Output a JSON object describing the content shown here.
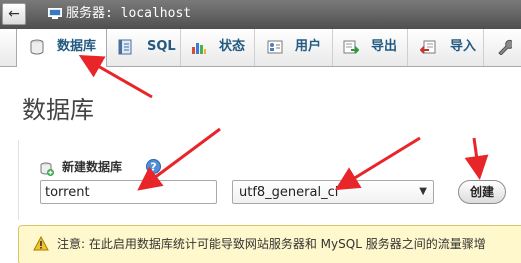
{
  "topbar": {
    "back_label": "←",
    "server_label": "服务器: localhost"
  },
  "tabs": [
    {
      "label": "数据库",
      "icon": "database-icon",
      "active": true
    },
    {
      "label": "SQL",
      "icon": "sql-icon",
      "active": false
    },
    {
      "label": "状态",
      "icon": "status-chart-icon",
      "active": false
    },
    {
      "label": "用户",
      "icon": "users-icon",
      "active": false
    },
    {
      "label": "导出",
      "icon": "export-icon",
      "active": false
    },
    {
      "label": "导入",
      "icon": "import-icon",
      "active": false
    },
    {
      "label": "",
      "icon": "wrench-icon",
      "active": false
    }
  ],
  "page": {
    "title": "数据库"
  },
  "create_db": {
    "label": "新建数据库",
    "name_value": "torrent",
    "collation_value": "utf8_general_ci",
    "create_button": "创建"
  },
  "notice": {
    "text": "注意: 在此启用数据库统计可能导致网站服务器和 MySQL 服务器之间的流量骤增"
  },
  "colors": {
    "annotation_red": "#e8262a",
    "tab_text": "#235a81",
    "notice_bg": "#fff8cc"
  }
}
